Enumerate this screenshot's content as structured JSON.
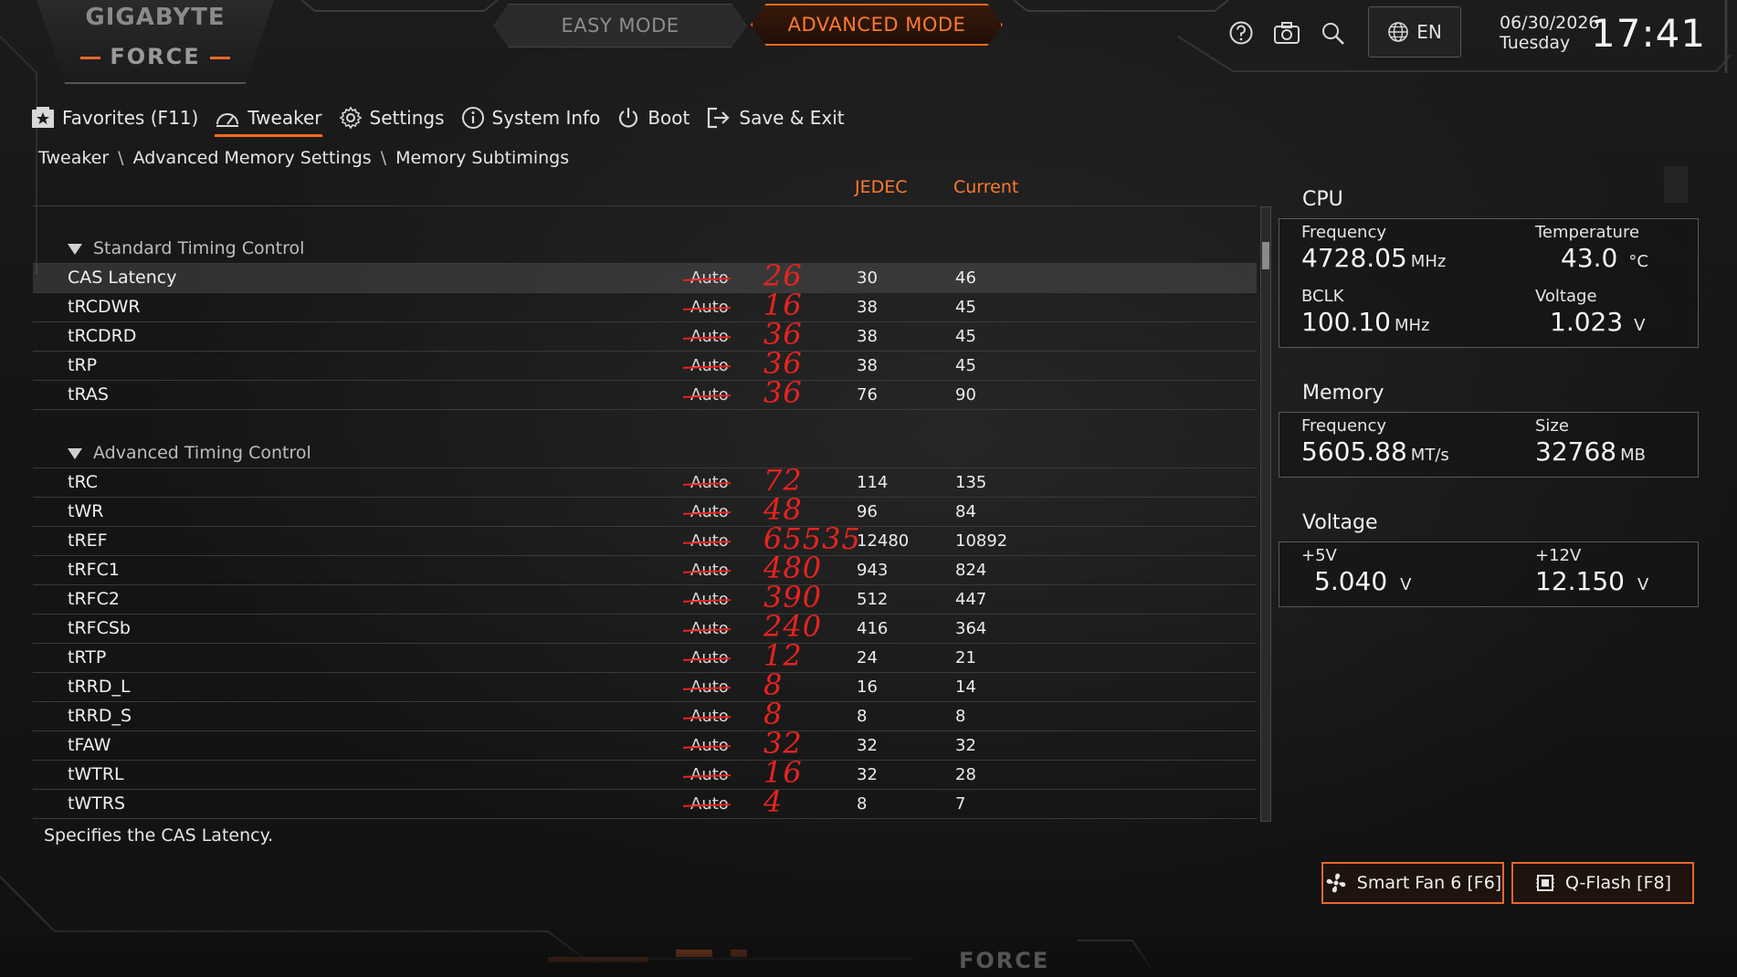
{
  "brand": {
    "name": "GIGABYTE",
    "sub": "FORCE"
  },
  "modes": {
    "easy": "EASY MODE",
    "advanced": "ADVANCED MODE"
  },
  "topbar": {
    "icons": [
      "help-icon",
      "camera-icon",
      "search-icon"
    ],
    "language": "EN",
    "date": "06/30/2026",
    "weekday": "Tuesday",
    "time": "17:41"
  },
  "nav": [
    {
      "label": "Favorites (F11)",
      "icon": "favorites-star-icon"
    },
    {
      "label": "Tweaker",
      "icon": "speedometer-icon",
      "active": true
    },
    {
      "label": "Settings",
      "icon": "gear-icon"
    },
    {
      "label": "System Info",
      "icon": "info-icon"
    },
    {
      "label": "Boot",
      "icon": "power-icon"
    },
    {
      "label": "Save & Exit",
      "icon": "exit-icon"
    }
  ],
  "breadcrumb": [
    "Tweaker",
    "Advanced Memory Settings",
    "Memory Subtimings"
  ],
  "breadcrumb_sep": "\\",
  "columns": {
    "jedec": "JEDEC",
    "current": "Current"
  },
  "sections": [
    {
      "title": "Standard Timing Control",
      "rows": [
        {
          "name": "CAS Latency",
          "value": "Auto",
          "handwritten": "26",
          "jedec": "30",
          "current": "46",
          "selected": true
        },
        {
          "name": "tRCDWR",
          "value": "Auto",
          "handwritten": "16",
          "jedec": "38",
          "current": "45"
        },
        {
          "name": "tRCDRD",
          "value": "Auto",
          "handwritten": "36",
          "jedec": "38",
          "current": "45"
        },
        {
          "name": "tRP",
          "value": "Auto",
          "handwritten": "36",
          "jedec": "38",
          "current": "45"
        },
        {
          "name": "tRAS",
          "value": "Auto",
          "handwritten": "36",
          "jedec": "76",
          "current": "90"
        }
      ]
    },
    {
      "title": "Advanced Timing Control",
      "rows": [
        {
          "name": "tRC",
          "value": "Auto",
          "handwritten": "72",
          "jedec": "114",
          "current": "135"
        },
        {
          "name": "tWR",
          "value": "Auto",
          "handwritten": "48",
          "jedec": "96",
          "current": "84"
        },
        {
          "name": "tREF",
          "value": "Auto",
          "handwritten": "65535",
          "jedec": "12480",
          "current": "10892"
        },
        {
          "name": "tRFC1",
          "value": "Auto",
          "handwritten": "480",
          "jedec": "943",
          "current": "824"
        },
        {
          "name": "tRFC2",
          "value": "Auto",
          "handwritten": "390",
          "jedec": "512",
          "current": "447"
        },
        {
          "name": "tRFCSb",
          "value": "Auto",
          "handwritten": "240",
          "jedec": "416",
          "current": "364"
        },
        {
          "name": "tRTP",
          "value": "Auto",
          "handwritten": "12",
          "jedec": "24",
          "current": "21"
        },
        {
          "name": "tRRD_L",
          "value": "Auto",
          "handwritten": "8",
          "jedec": "16",
          "current": "14"
        },
        {
          "name": "tRRD_S",
          "value": "Auto",
          "handwritten": "8",
          "jedec": "8",
          "current": "8"
        },
        {
          "name": "tFAW",
          "value": "Auto",
          "handwritten": "32",
          "jedec": "32",
          "current": "32"
        },
        {
          "name": "tWTRL",
          "value": "Auto",
          "handwritten": "16",
          "jedec": "32",
          "current": "28"
        },
        {
          "name": "tWTRS",
          "value": "Auto",
          "handwritten": "4",
          "jedec": "8",
          "current": "7"
        }
      ]
    }
  ],
  "help_text": "Specifies the CAS Latency.",
  "cpu": {
    "title": "CPU",
    "frequency_label": "Frequency",
    "frequency": "4728.05",
    "frequency_unit": "MHz",
    "temperature_label": "Temperature",
    "temperature": "43.0",
    "temperature_unit": "°C",
    "bclk_label": "BCLK",
    "bclk": "100.10",
    "bclk_unit": "MHz",
    "voltage_label": "Voltage",
    "voltage": "1.023",
    "voltage_unit": "V"
  },
  "memory": {
    "title": "Memory",
    "frequency_label": "Frequency",
    "frequency": "5605.88",
    "frequency_unit": "MT/s",
    "size_label": "Size",
    "size": "32768",
    "size_unit": "MB"
  },
  "voltage": {
    "title": "Voltage",
    "v5_label": "+5V",
    "v5": "5.040",
    "v5_unit": "V",
    "v12_label": "+12V",
    "v12": "12.150",
    "v12_unit": "V"
  },
  "buttons": {
    "smartfan": "Smart Fan 6 [F6]",
    "qflash": "Q-Flash [F8]"
  },
  "footer_brand": "FORCE",
  "colors": {
    "accent": "#ff6a1a",
    "handwriting": "#e8231f"
  }
}
